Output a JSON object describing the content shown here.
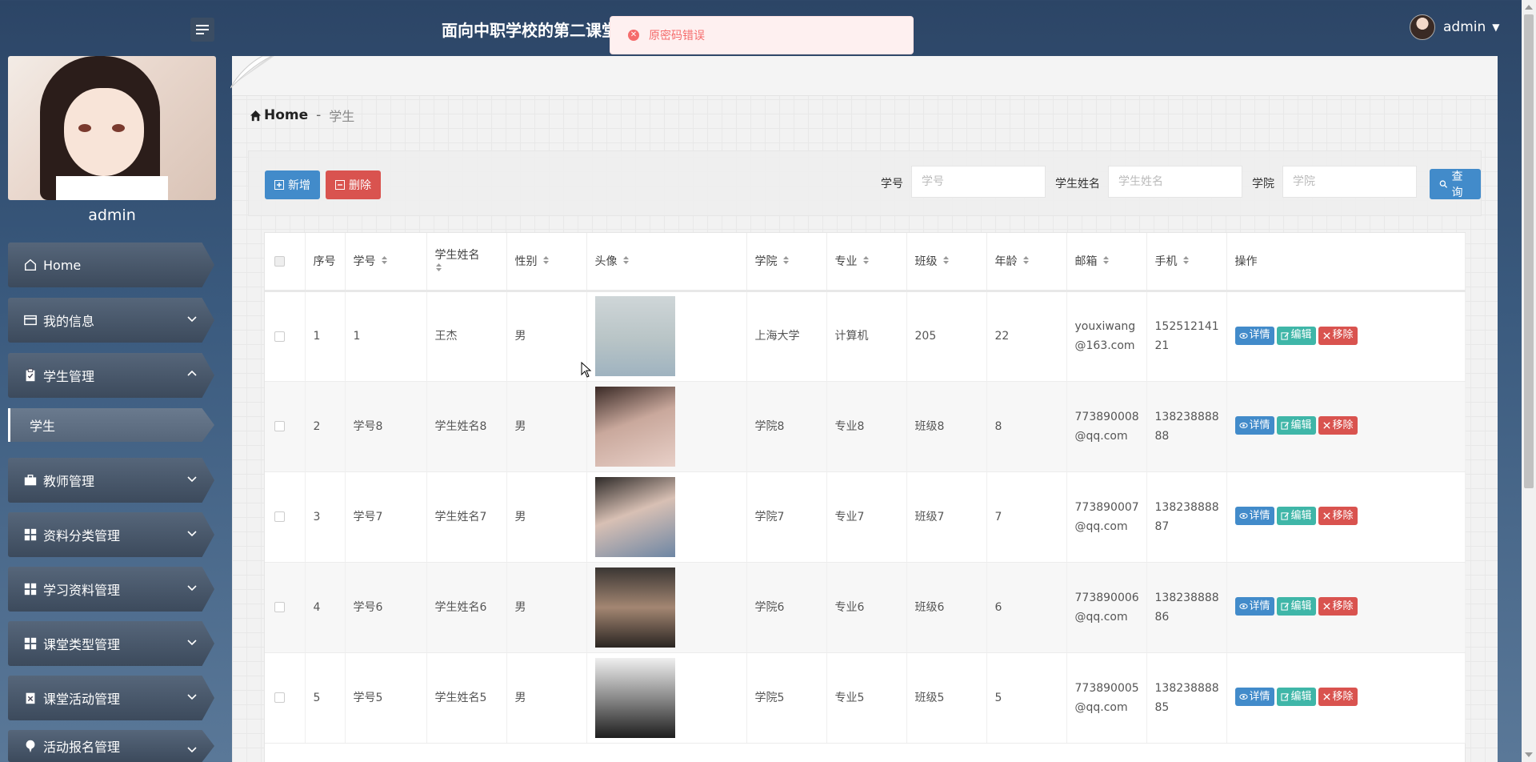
{
  "app": {
    "title": "面向中职学校的第二课堂"
  },
  "toast": {
    "message": "原密码错误"
  },
  "user": {
    "name": "admin"
  },
  "sidebar": {
    "profile_name": "admin",
    "items": [
      {
        "label": "Home",
        "icon": "home-icon"
      },
      {
        "label": "我的信息",
        "icon": "id-card-icon"
      },
      {
        "label": "学生管理",
        "icon": "clipboard-icon",
        "expanded": true
      },
      {
        "label": "学生",
        "sub": true,
        "active": true
      },
      {
        "label": "教师管理",
        "icon": "briefcase-icon"
      },
      {
        "label": "资料分类管理",
        "icon": "grid-icon"
      },
      {
        "label": "学习资料管理",
        "icon": "grid-icon"
      },
      {
        "label": "课堂类型管理",
        "icon": "grid-icon"
      },
      {
        "label": "课堂活动管理",
        "icon": "clipboard-x-icon"
      },
      {
        "label": "活动报名管理",
        "icon": "pin-icon"
      }
    ]
  },
  "breadcrumb": {
    "home": "Home",
    "sep": "-",
    "current": "学生"
  },
  "toolbar": {
    "add_label": "新增",
    "delete_label": "删除",
    "search_label": "查询",
    "filters": [
      {
        "label": "学号",
        "placeholder": "学号"
      },
      {
        "label": "学生姓名",
        "placeholder": "学生姓名"
      },
      {
        "label": "学院",
        "placeholder": "学院"
      }
    ]
  },
  "table": {
    "headers": [
      "序号",
      "学号",
      "学生姓名",
      "性别",
      "头像",
      "学院",
      "专业",
      "班级",
      "年龄",
      "邮箱",
      "手机",
      "操作"
    ],
    "actions": {
      "detail": "详情",
      "edit": "编辑",
      "remove": "移除"
    },
    "rows": [
      {
        "idx": "1",
        "sid": "1",
        "name": "王杰",
        "gender": "男",
        "college": "上海大学",
        "major": "计算机",
        "cls": "205",
        "age": "22",
        "email1": "youxiwang",
        "email2": "@163.com",
        "phone1": "152512141",
        "phone2": "21"
      },
      {
        "idx": "2",
        "sid": "学号8",
        "name": "学生姓名8",
        "gender": "男",
        "college": "学院8",
        "major": "专业8",
        "cls": "班级8",
        "age": "8",
        "email1": "773890008",
        "email2": "@qq.com",
        "phone1": "138238888",
        "phone2": "88"
      },
      {
        "idx": "3",
        "sid": "学号7",
        "name": "学生姓名7",
        "gender": "男",
        "college": "学院7",
        "major": "专业7",
        "cls": "班级7",
        "age": "7",
        "email1": "773890007",
        "email2": "@qq.com",
        "phone1": "138238888",
        "phone2": "87"
      },
      {
        "idx": "4",
        "sid": "学号6",
        "name": "学生姓名6",
        "gender": "男",
        "college": "学院6",
        "major": "专业6",
        "cls": "班级6",
        "age": "6",
        "email1": "773890006",
        "email2": "@qq.com",
        "phone1": "138238888",
        "phone2": "86"
      },
      {
        "idx": "5",
        "sid": "学号5",
        "name": "学生姓名5",
        "gender": "男",
        "college": "学院5",
        "major": "专业5",
        "cls": "班级5",
        "age": "5",
        "email1": "773890005",
        "email2": "@qq.com",
        "phone1": "138238888",
        "phone2": "85"
      }
    ]
  },
  "colors": {
    "primary": "#428bca",
    "danger": "#d9534f",
    "teal": "#3fb6a8",
    "toast_text": "#f56c6c"
  }
}
